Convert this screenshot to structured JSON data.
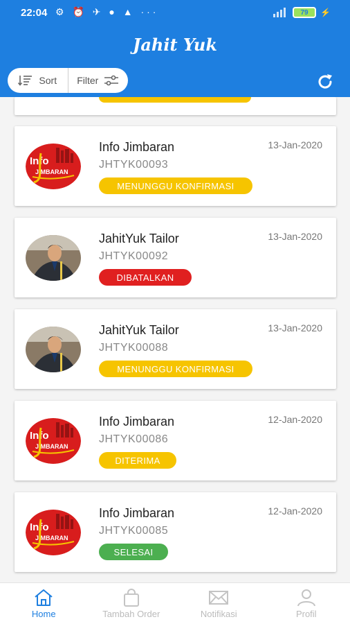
{
  "status_bar": {
    "time": "22:04",
    "battery": "79"
  },
  "app": {
    "title": "Jahit Yuk"
  },
  "toolbar": {
    "sort_label": "Sort",
    "filter_label": "Filter"
  },
  "orders": [
    {
      "name": "Info Jimbaran",
      "code": "JHTYK00093",
      "date": "13-Jan-2020",
      "status": "MENUNGGU KONFIRMASI",
      "status_color": "#f6c400",
      "avatar": "info-jimbaran-logo",
      "logo_text_1": "Info",
      "logo_text_2": "JIMBARAN"
    },
    {
      "name": "JahitYuk Tailor",
      "code": "JHTYK00092",
      "date": "13-Jan-2020",
      "status": "DIBATALKAN",
      "status_color": "#e02020",
      "avatar": "tailor-photo"
    },
    {
      "name": "JahitYuk Tailor",
      "code": "JHTYK00088",
      "date": "13-Jan-2020",
      "status": "MENUNGGU KONFIRMASI",
      "status_color": "#f6c400",
      "avatar": "tailor-photo"
    },
    {
      "name": "Info Jimbaran",
      "code": "JHTYK00086",
      "date": "12-Jan-2020",
      "status": "DITERIMA",
      "status_color": "#f6c400",
      "avatar": "info-jimbaran-logo",
      "logo_text_1": "Info",
      "logo_text_2": "JIMBARAN"
    },
    {
      "name": "Info Jimbaran",
      "code": "JHTYK00085",
      "date": "12-Jan-2020",
      "status": "SELESAI",
      "status_color": "#4caf50",
      "avatar": "info-jimbaran-logo",
      "logo_text_1": "Info",
      "logo_text_2": "JIMBARAN"
    }
  ],
  "bottom_nav": [
    {
      "label": "Home",
      "icon": "home-icon",
      "active": true
    },
    {
      "label": "Tambah Order",
      "icon": "shopping-bag-icon",
      "active": false
    },
    {
      "label": "Notifikasi",
      "icon": "mail-icon",
      "active": false
    },
    {
      "label": "Profil",
      "icon": "person-icon",
      "active": false
    }
  ],
  "colors": {
    "primary": "#1e7fe0",
    "pending": "#f6c400",
    "cancelled": "#e02020",
    "done": "#4caf50"
  }
}
